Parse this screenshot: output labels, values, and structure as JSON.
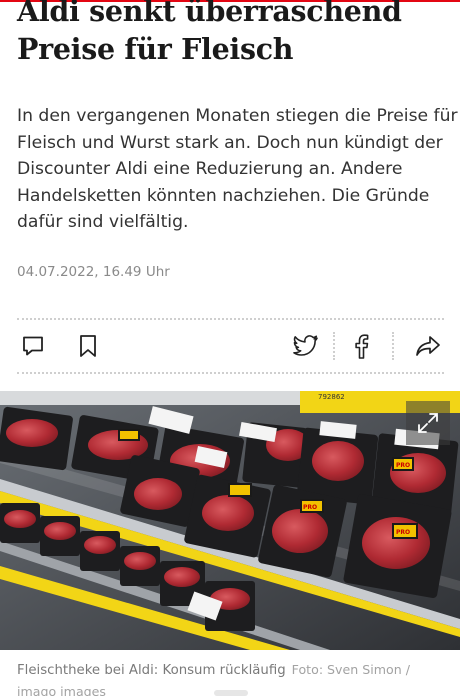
{
  "article": {
    "headline_line1": "Aldi senkt überraschend",
    "headline_line2": "Preise für Fleisch",
    "teaser_lines": [
      "In den vergangenen Monaten stiegen die Preise für",
      "Fleisch und Wurst stark an. Doch nun kündigt der",
      "Discounter Aldi eine Reduzierung an. Andere",
      "Handelsketten könnten nachziehen. Die Gründe",
      "dafür sind vielfältig."
    ],
    "date": "04.07.2022, 16.49 Uhr"
  },
  "actions": {
    "icons": [
      "comment-icon",
      "bookmark-icon",
      "twitter-icon",
      "facebook-icon",
      "share-icon"
    ]
  },
  "photo": {
    "shelf_number": "792862",
    "label_text": "PRO",
    "caption": "Fleischtheke bei Aldi: Konsum rückläufig",
    "credit_line1": "Foto: Sven Simon /",
    "credit_line2": "imago images"
  },
  "colors": {
    "accent": "#e30613",
    "shelf_yellow": "#f2d516",
    "meat": "#b8323a",
    "tray": "#1d1d1f"
  }
}
